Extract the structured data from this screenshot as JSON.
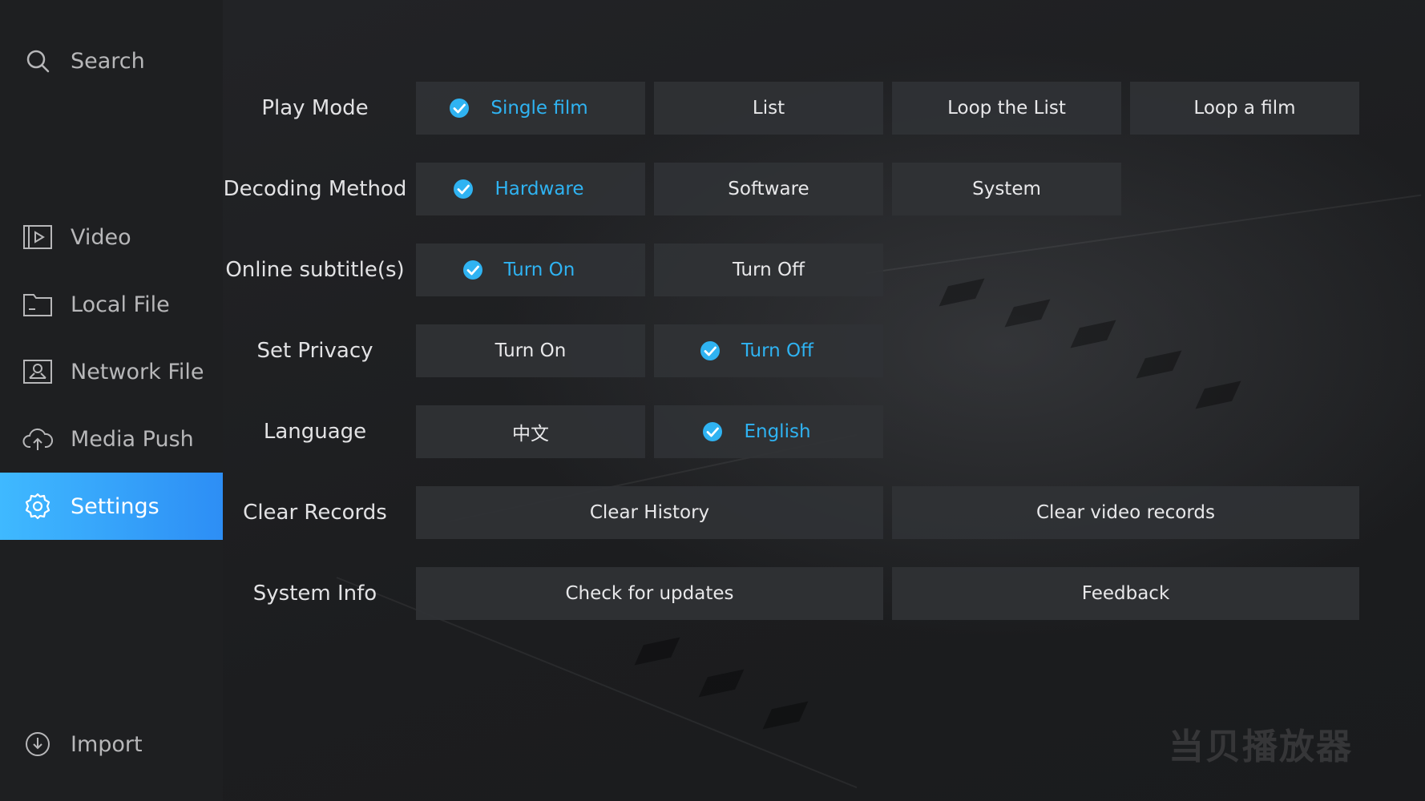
{
  "sidebar": {
    "search_label": "Search",
    "items": [
      {
        "label": "Video",
        "icon": "video-icon"
      },
      {
        "label": "Local File",
        "icon": "folder-icon"
      },
      {
        "label": "Network File",
        "icon": "network-icon"
      },
      {
        "label": "Media Push",
        "icon": "cloud-upload-icon"
      },
      {
        "label": "Settings",
        "icon": "gear-icon",
        "active": true
      }
    ],
    "import_label": "Import"
  },
  "settings": {
    "play_mode": {
      "label": "Play Mode",
      "options": [
        "Single film",
        "List",
        "Loop the List",
        "Loop a film"
      ],
      "selected": "Single film"
    },
    "decoding_method": {
      "label": "Decoding Method",
      "options": [
        "Hardware",
        "Software",
        "System"
      ],
      "selected": "Hardware"
    },
    "online_subtitles": {
      "label": "Online subtitle(s)",
      "options": [
        "Turn On",
        "Turn Off"
      ],
      "selected": "Turn On"
    },
    "set_privacy": {
      "label": "Set Privacy",
      "options": [
        "Turn On",
        "Turn Off"
      ],
      "selected": "Turn Off"
    },
    "language": {
      "label": "Language",
      "options": [
        "中文",
        "English"
      ],
      "selected": "English"
    },
    "clear_records": {
      "label": "Clear Records",
      "options": [
        "Clear History",
        "Clear video records"
      ]
    },
    "system_info": {
      "label": "System Info",
      "options": [
        "Check for updates",
        "Feedback"
      ]
    }
  },
  "watermark": "当贝播放器",
  "colors": {
    "accent": "#2fb3f2",
    "active_nav_start": "#3fb9ff",
    "active_nav_end": "#2d8ef5",
    "option_bg": "#303235"
  }
}
